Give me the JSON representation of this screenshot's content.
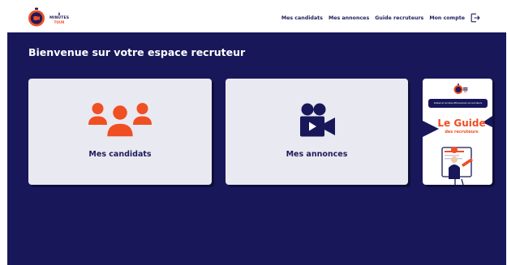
{
  "header": {
    "logo": {
      "line1": "8",
      "line2": "MINUTES",
      "line3": "TOUR"
    },
    "nav": [
      {
        "label": "Mes candidats"
      },
      {
        "label": "Mes annonces"
      },
      {
        "label": "Guide recruteurs"
      },
      {
        "label": "Mon compte"
      }
    ],
    "logout_icon": "logout-icon"
  },
  "main": {
    "welcome": "Bienvenue sur votre espace recruteur",
    "cards": [
      {
        "label": "Mes candidats",
        "icon": "users-icon"
      },
      {
        "label": "Mes annonces",
        "icon": "video-camera-icon"
      }
    ],
    "guide": {
      "banner": "Publiez et recrutez efficacement vos recruteurs",
      "title": "Le Guide",
      "subtitle": "des recruteurs"
    }
  },
  "colors": {
    "navy": "#18175a",
    "accent": "#f04e23",
    "card_bg": "#e9e9f1",
    "text_dark": "#1c1c5c"
  }
}
